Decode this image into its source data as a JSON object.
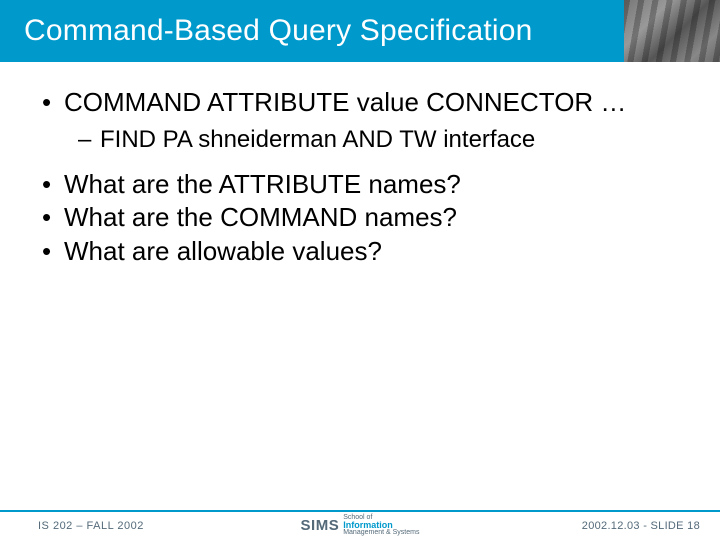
{
  "title": "Command-Based Query Specification",
  "bullets": {
    "b1": "COMMAND ATTRIBUTE value CONNECTOR …",
    "s1": "FIND PA shneiderman AND TW interface",
    "b2": "What are the ATTRIBUTE names?",
    "b3": "What are the COMMAND names?",
    "b4": "What are allowable values?"
  },
  "footer": {
    "left": "IS 202 – FALL 2002",
    "right": "2002.12.03 - SLIDE 18",
    "logo": {
      "brand": "SIMS",
      "line1": "School of",
      "line2": "Information",
      "line3": "Management & Systems"
    }
  }
}
